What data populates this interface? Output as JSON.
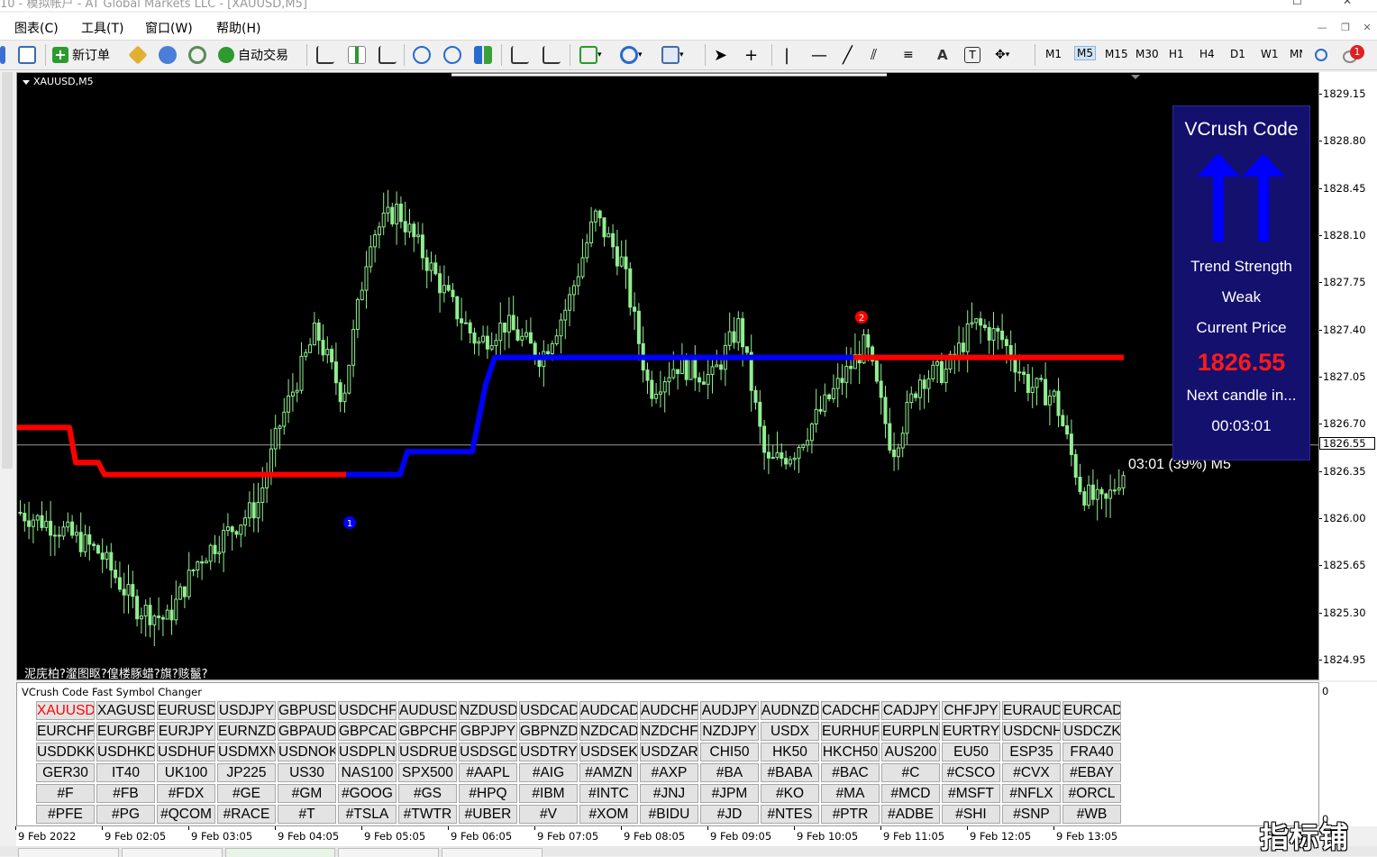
{
  "window": {
    "title": "10 - 模拟帐户 - AT Global Markets LLC - [XAUUSD,M5]"
  },
  "menu": {
    "items": [
      {
        "label": "图表(C)"
      },
      {
        "label": "工具(T)"
      },
      {
        "label": "窗口(W)"
      },
      {
        "label": "帮助(H)"
      }
    ]
  },
  "toolbar": {
    "new_order_label": "新订单",
    "auto_trade_label": "自动交易",
    "timeframes": [
      "M1",
      "M5",
      "M15",
      "M30",
      "H1",
      "H4",
      "D1",
      "W1",
      "MN"
    ],
    "active_timeframe": "M5",
    "notification_count": "1"
  },
  "chart": {
    "symbol_label": "XAUUSD,M5",
    "garbled_text": "泥庑柏?瀣图眍?偟楼豚蜡?旗?赅鬣?",
    "timer_text": "03:01 (39%) M5",
    "signal_1": "1",
    "signal_2": "2",
    "current_price": "1826.55",
    "price_axis": [
      "1829.15",
      "1828.80",
      "1828.45",
      "1828.10",
      "1827.75",
      "1827.40",
      "1827.05",
      "1826.70",
      "1826.35",
      "1826.00",
      "1825.65",
      "1825.30",
      "1824.95"
    ],
    "time_axis": [
      "9 Feb 2022",
      "9 Feb 02:05",
      "9 Feb 03:05",
      "9 Feb 04:05",
      "9 Feb 05:05",
      "9 Feb 06:05",
      "9 Feb 07:05",
      "9 Feb 08:05",
      "9 Feb 09:05",
      "9 Feb 10:05",
      "9 Feb 11:05",
      "9 Feb 12:05",
      "9 Feb 13:05"
    ],
    "colors": {
      "bull": "#90ee90",
      "trend_up": "#0000ff",
      "trend_down": "#ff0000",
      "background": "#000000"
    }
  },
  "vcrush_panel": {
    "title": "VCrush Code",
    "trend_label": "Trend Strength",
    "trend_value": "Weak",
    "price_label": "Current Price",
    "price_value": "1826.55",
    "next_candle_label": "Next candle in...",
    "countdown": "00:03:01",
    "arrow_direction": "up",
    "colors": {
      "background": "#14106e",
      "arrow": "#0000ff",
      "price": "#ff1a1a"
    }
  },
  "symbol_changer": {
    "title": "VCrush Code Fast Symbol Changer",
    "active": "XAUUSD",
    "axis_top": "0",
    "axis_bottom": "0",
    "rows": [
      [
        "XAUUSD",
        "XAGUSD",
        "EURUSD",
        "USDJPY",
        "GBPUSD",
        "USDCHF",
        "AUDUSD",
        "NZDUSD",
        "USDCAD",
        "AUDCAD",
        "AUDCHF",
        "AUDJPY",
        "AUDNZD",
        "CADCHF",
        "CADJPY",
        "CHFJPY",
        "EURAUD",
        "EURCAD"
      ],
      [
        "EURCHF",
        "EURGBP",
        "EURJPY",
        "EURNZD",
        "GBPAUD",
        "GBPCAD",
        "GBPCHF",
        "GBPJPY",
        "GBPNZD",
        "NZDCAD",
        "NZDCHF",
        "NZDJPY",
        "USDX",
        "EURHUF",
        "EURPLN",
        "EURTRY",
        "USDCNH",
        "USDCZK"
      ],
      [
        "USDDKK",
        "USDHKD",
        "USDHUF",
        "USDMXN",
        "USDNOK",
        "USDPLN",
        "USDRUB",
        "USDSGD",
        "USDTRY",
        "USDSEK",
        "USDZAR",
        "CHI50",
        "HK50",
        "HKCH50",
        "AUS200",
        "EU50",
        "ESP35",
        "FRA40"
      ],
      [
        "GER30",
        "IT40",
        "UK100",
        "JP225",
        "US30",
        "NAS100",
        "SPX500",
        "#AAPL",
        "#AIG",
        "#AMZN",
        "#AXP",
        "#BA",
        "#BABA",
        "#BAC",
        "#C",
        "#CSCO",
        "#CVX",
        "#EBAY"
      ],
      [
        "#F",
        "#FB",
        "#FDX",
        "#GE",
        "#GM",
        "#GOOG",
        "#GS",
        "#HPQ",
        "#IBM",
        "#INTC",
        "#JNJ",
        "#JPM",
        "#KO",
        "#MA",
        "#MCD",
        "#MSFT",
        "#NFLX",
        "#ORCL"
      ],
      [
        "#PFE",
        "#PG",
        "#QCOM",
        "#RACE",
        "#T",
        "#TSLA",
        "#TWTR",
        "#UBER",
        "#V",
        "#XOM",
        "#BIDU",
        "#JD",
        "#NTES",
        "#PTR",
        "#ADBE",
        "#SHI",
        "#SNP",
        "#WB"
      ]
    ]
  },
  "watermark": "指标铺"
}
